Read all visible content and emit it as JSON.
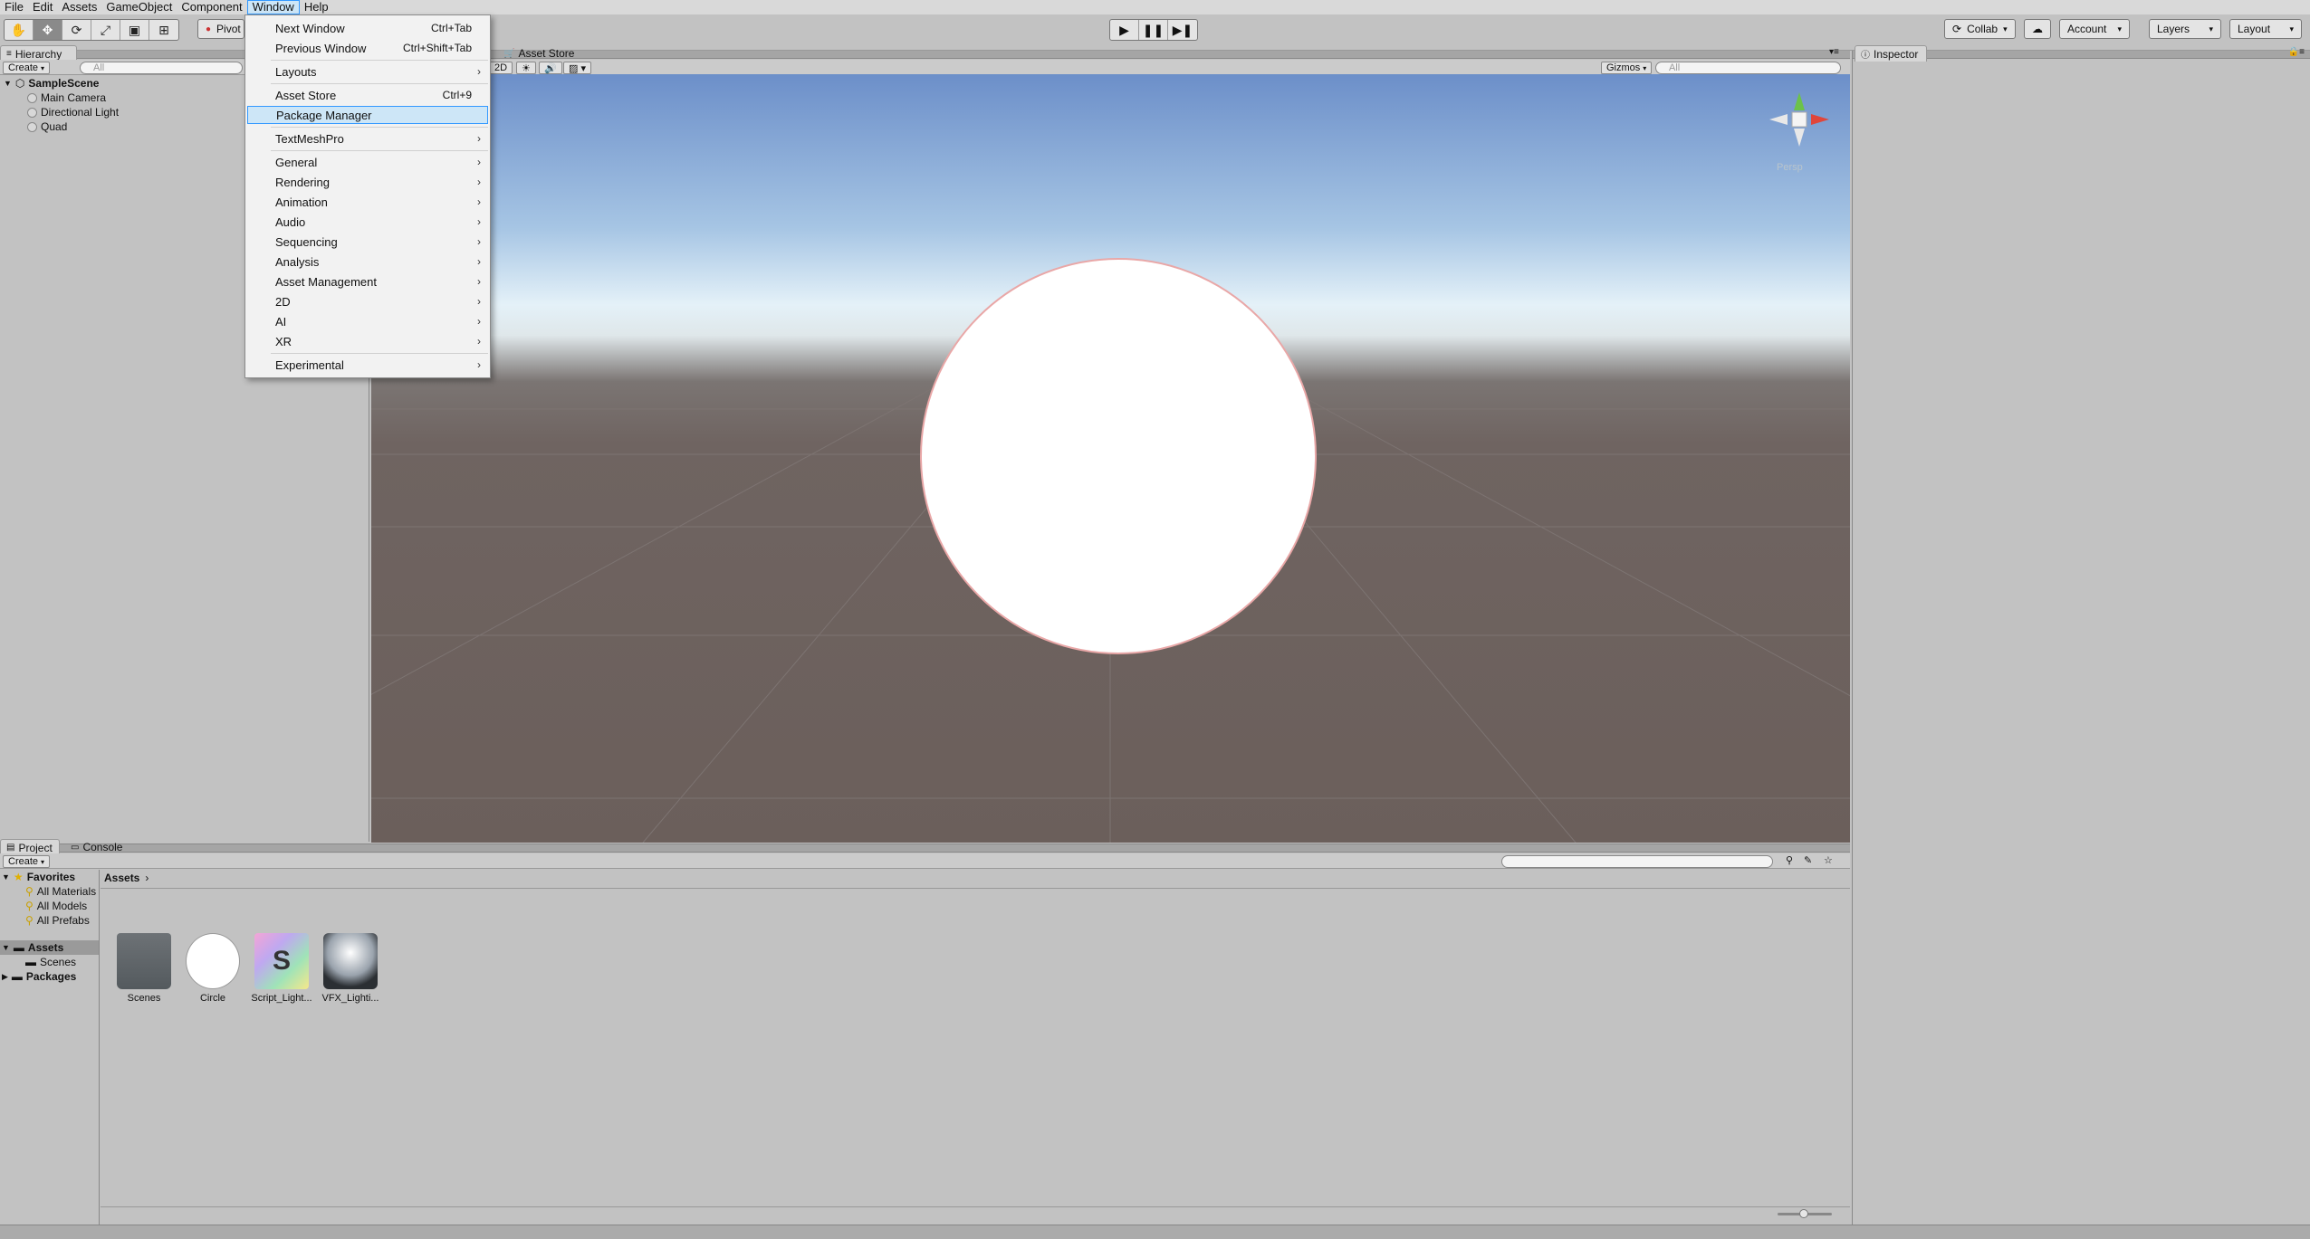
{
  "menubar": {
    "items": [
      "File",
      "Edit",
      "Assets",
      "GameObject",
      "Component",
      "Window",
      "Help"
    ],
    "active": "Window"
  },
  "toolbar": {
    "pivot_label": "Pivot",
    "collab_label": "Collab",
    "account_label": "Account",
    "layers_label": "Layers",
    "layout_label": "Layout",
    "transform_tools": [
      "hand-tool-icon",
      "move-tool-icon",
      "rotate-tool-icon",
      "scale-tool-icon",
      "rect-tool-icon",
      "transform-tool-icon"
    ],
    "play_controls": [
      "play-icon",
      "pause-icon",
      "step-icon"
    ]
  },
  "hierarchy": {
    "tab_label": "Hierarchy",
    "create_label": "Create",
    "search_placeholder": "All",
    "scene_name": "SampleScene",
    "objects": [
      "Main Camera",
      "Directional Light",
      "Quad"
    ]
  },
  "window_menu": {
    "items": [
      {
        "label": "Next Window",
        "shortcut": "Ctrl+Tab"
      },
      {
        "label": "Previous Window",
        "shortcut": "Ctrl+Shift+Tab"
      },
      {
        "label": "Layouts",
        "submenu": true
      },
      {
        "label": "Asset Store",
        "shortcut": "Ctrl+9"
      },
      {
        "label": "Package Manager",
        "highlighted": true
      },
      {
        "label": "TextMeshPro",
        "submenu": true
      },
      {
        "label": "General",
        "submenu": true
      },
      {
        "label": "Rendering",
        "submenu": true
      },
      {
        "label": "Animation",
        "submenu": true
      },
      {
        "label": "Audio",
        "submenu": true
      },
      {
        "label": "Sequencing",
        "submenu": true
      },
      {
        "label": "Analysis",
        "submenu": true
      },
      {
        "label": "Asset Management",
        "submenu": true
      },
      {
        "label": "2D",
        "submenu": true
      },
      {
        "label": "AI",
        "submenu": true
      },
      {
        "label": "XR",
        "submenu": true
      },
      {
        "label": "Experimental",
        "submenu": true
      }
    ]
  },
  "scene": {
    "asset_store_tab": "Asset Store",
    "mode_2d_label": "2D",
    "gizmos_label": "Gizmos",
    "search_placeholder": "All",
    "gizmo_label": "Persp",
    "sky_color": "#a6c5e4",
    "ground_color": "#6b5f5b",
    "object_color": "#ffffff"
  },
  "inspector": {
    "tab_label": "Inspector"
  },
  "project": {
    "tab_label": "Project",
    "console_tab_label": "Console",
    "create_label": "Create",
    "breadcrumb": "Assets",
    "favorites_label": "Favorites",
    "favorites": [
      "All Materials",
      "All Models",
      "All Prefabs"
    ],
    "assets_label": "Assets",
    "assets_children": [
      "Scenes"
    ],
    "packages_label": "Packages",
    "assets": [
      {
        "name": "Scenes",
        "kind": "folder"
      },
      {
        "name": "Circle",
        "kind": "sprite"
      },
      {
        "name": "Script_Light...",
        "kind": "shader"
      },
      {
        "name": "VFX_Lighti...",
        "kind": "vfx"
      }
    ]
  }
}
